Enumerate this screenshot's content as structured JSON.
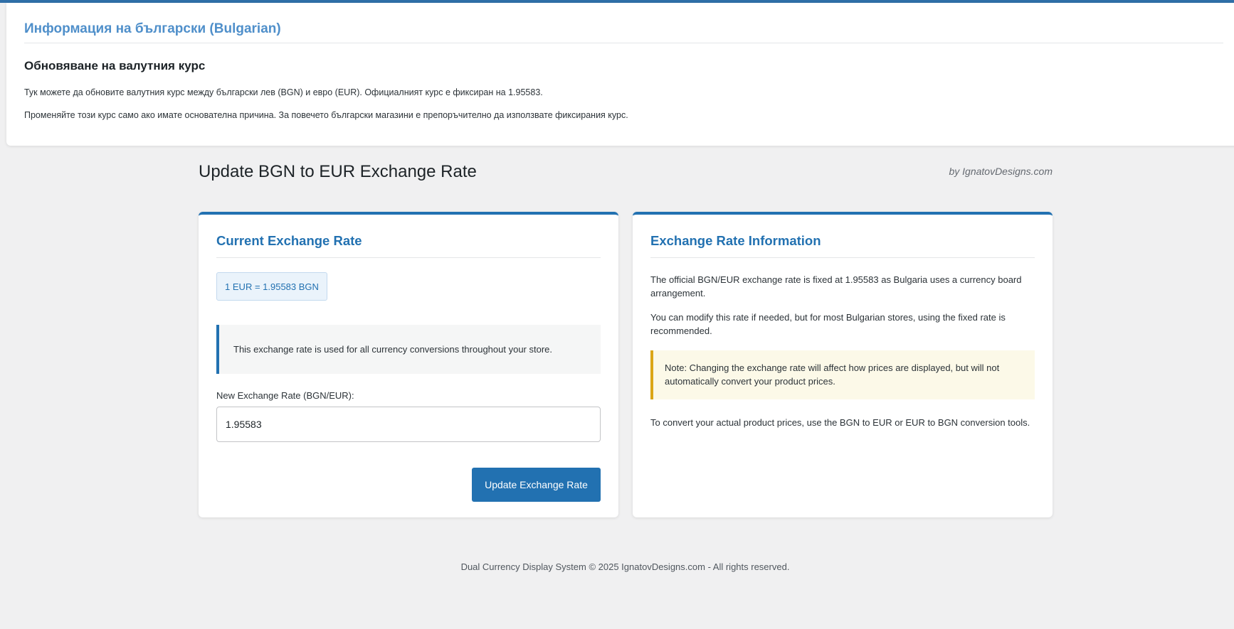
{
  "bulgarian_box": {
    "title": "Информация на български (Bulgarian)",
    "subtitle": "Обновяване на валутния курс",
    "paragraph1": "Тук можете да обновите валутния курс между български лев (BGN) и евро (EUR). Официалният курс е фиксиран на 1.95583.",
    "paragraph2": "Променяйте този курс само ако имате основателна причина. За повечето български магазини е препоръчително да използвате фиксирания курс."
  },
  "header": {
    "title": "Update BGN to EUR Exchange Rate",
    "credit": "by IgnatovDesigns.com"
  },
  "current_rate_card": {
    "title": "Current Exchange Rate",
    "rate_badge": "1 EUR = 1.95583 BGN",
    "info_notice": "This exchange rate is used for all currency conversions throughout your store.",
    "field_label": "New Exchange Rate (BGN/EUR):",
    "field_value": "1.95583",
    "button_label": "Update Exchange Rate"
  },
  "info_card": {
    "title": "Exchange Rate Information",
    "paragraph1": "The official BGN/EUR exchange rate is fixed at 1.95583 as Bulgaria uses a currency board arrangement.",
    "paragraph2": "You can modify this rate if needed, but for most Bulgarian stores, using the fixed rate is recommended.",
    "warning_notice": "Note: Changing the exchange rate will affect how prices are displayed, but will not automatically convert your product prices.",
    "paragraph3": "To convert your actual product prices, use the BGN to EUR or EUR to BGN conversion tools."
  },
  "footer": {
    "text": "Dual Currency Display System © 2025 IgnatovDesigns.com - All rights reserved."
  },
  "colors": {
    "accent": "#2271b1",
    "bulgarian_title": "#4f8fca",
    "warning_border": "#dba617",
    "page_background": "#f0f0f1"
  }
}
